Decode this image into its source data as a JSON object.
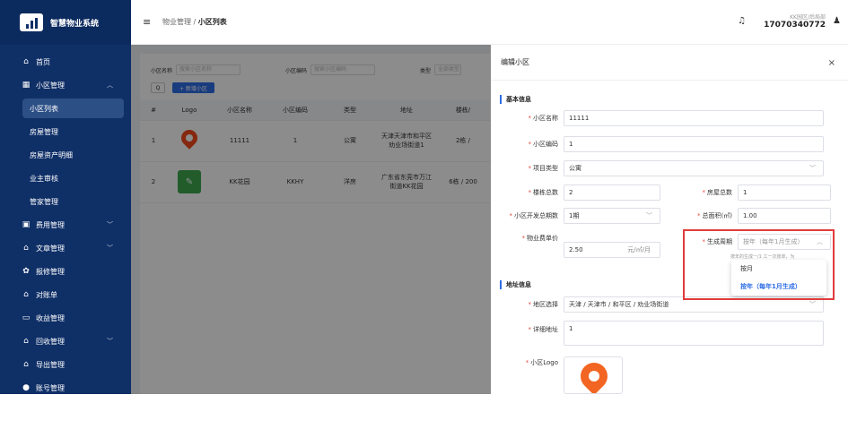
{
  "brand": {
    "title": "智慧物业系统"
  },
  "sidebar": {
    "items": [
      {
        "label": "首页",
        "icon": "home-icon"
      },
      {
        "label": "小区管理",
        "icon": "building-icon",
        "expanded": true
      },
      {
        "label": "小区列表",
        "active": true
      },
      {
        "label": "房屋管理"
      },
      {
        "label": "房屋资产明细"
      },
      {
        "label": "业主审核"
      },
      {
        "label": "管家管理"
      },
      {
        "label": "费用管理",
        "icon": "fee-icon"
      },
      {
        "label": "文章管理",
        "icon": "article-icon"
      },
      {
        "label": "报修管理",
        "icon": "gear-icon"
      },
      {
        "label": "对账单",
        "icon": "bill-icon"
      },
      {
        "label": "收益管理",
        "icon": "folder-icon"
      },
      {
        "label": "回收管理",
        "icon": "recycle-icon"
      },
      {
        "label": "导出管理",
        "icon": "export-icon"
      },
      {
        "label": "账号管理",
        "icon": "user-icon"
      }
    ]
  },
  "topbar": {
    "crumb_parent": "物业管理",
    "crumb_sep": "/",
    "crumb_current": "小区列表",
    "user_org": "KK园区/后局部",
    "user_phone": "17070340772"
  },
  "list": {
    "filters": [
      {
        "label": "小区名称",
        "placeholder": "搜索小区名称"
      },
      {
        "label": "小区编码",
        "placeholder": "搜索小区编码"
      },
      {
        "label": "类型",
        "placeholder": "全部类型"
      }
    ],
    "search_label": "Q",
    "add_label": "+ 新增小区",
    "columns": [
      "#",
      "Logo",
      "小区名称",
      "小区编码",
      "类型",
      "地址",
      "楼栋/"
    ],
    "rows": [
      {
        "idx": "1",
        "name": "11111",
        "code": "1",
        "type": "公寓",
        "address": "天津天津市和平区劝业场街道1",
        "buildings": "2栋 /"
      },
      {
        "idx": "2",
        "name": "KK花园",
        "code": "KKHY",
        "type": "洋房",
        "address": "广东省东莞市万江街道KK花园",
        "buildings": "6栋 / 200"
      }
    ]
  },
  "drawer": {
    "title": "编辑小区",
    "close": "×",
    "section_basic": "基本信息",
    "section_address": "地址信息",
    "fields": {
      "name_label": "小区名称",
      "name_value": "11111",
      "code_label": "小区编码",
      "code_value": "1",
      "type_label": "项目类型",
      "type_value": "公寓",
      "building_label": "楼栋总数",
      "building_value": "2",
      "house_label": "房屋总数",
      "house_value": "1",
      "phase_label": "小区开发总期数",
      "phase_value": "1期",
      "area_label": "总面积(㎡)",
      "area_value": "1.00",
      "fee_label": "物业费单价",
      "fee_value": "2.50",
      "fee_unit": "元/㎡/月",
      "cycle_label": "生成周期",
      "cycle_value": "按年（每年1月生成）",
      "cycle_hint": "按年的生成一/1 工一次账单，为",
      "region_label": "地区选择",
      "region_value": "天津 / 天津市 / 和平区 / 劝业场街道",
      "detail_label": "详细地址",
      "detail_value": "1",
      "logo_label": "小区Logo"
    },
    "cycle_options": [
      {
        "label": "按月",
        "selected": false
      },
      {
        "label": "按年（每年1月生成）",
        "selected": true
      }
    ]
  },
  "colors": {
    "sidebar": "#0f2f67",
    "primary": "#2f6ee5",
    "highlight": "#e23b3b"
  }
}
